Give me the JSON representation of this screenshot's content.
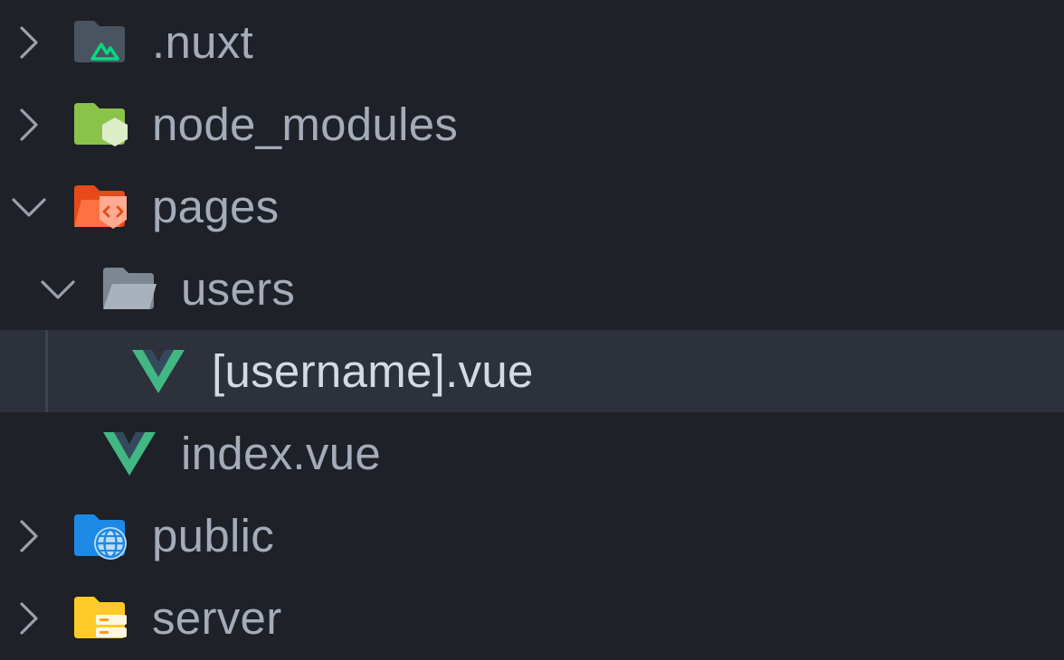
{
  "explorer": {
    "items": [
      {
        "label": ".nuxt",
        "icon": "nuxt-folder-icon",
        "state": "collapsed"
      },
      {
        "label": "node_modules",
        "icon": "node-folder-icon",
        "state": "collapsed"
      },
      {
        "label": "pages",
        "icon": "pages-folder-icon",
        "state": "expanded"
      },
      {
        "label": "users",
        "icon": "folder-open-icon",
        "state": "expanded"
      },
      {
        "label": "[username].vue",
        "icon": "vue-icon",
        "state": "selected"
      },
      {
        "label": "index.vue",
        "icon": "vue-icon",
        "state": "file"
      },
      {
        "label": "public",
        "icon": "public-folder-icon",
        "state": "collapsed"
      },
      {
        "label": "server",
        "icon": "server-folder-icon",
        "state": "collapsed"
      }
    ]
  },
  "colors": {
    "background": "#1e2127",
    "selected_row": "#2c313c",
    "text": "#a4acb9",
    "chevron": "#9aa1ad",
    "vue_green": "#41b883",
    "vue_dark": "#35495e",
    "nuxt_green": "#00dc82",
    "node_green": "#8bc34a",
    "pages_orange": "#ff7043",
    "public_blue": "#2196f3",
    "server_yellow": "#ffca28"
  }
}
